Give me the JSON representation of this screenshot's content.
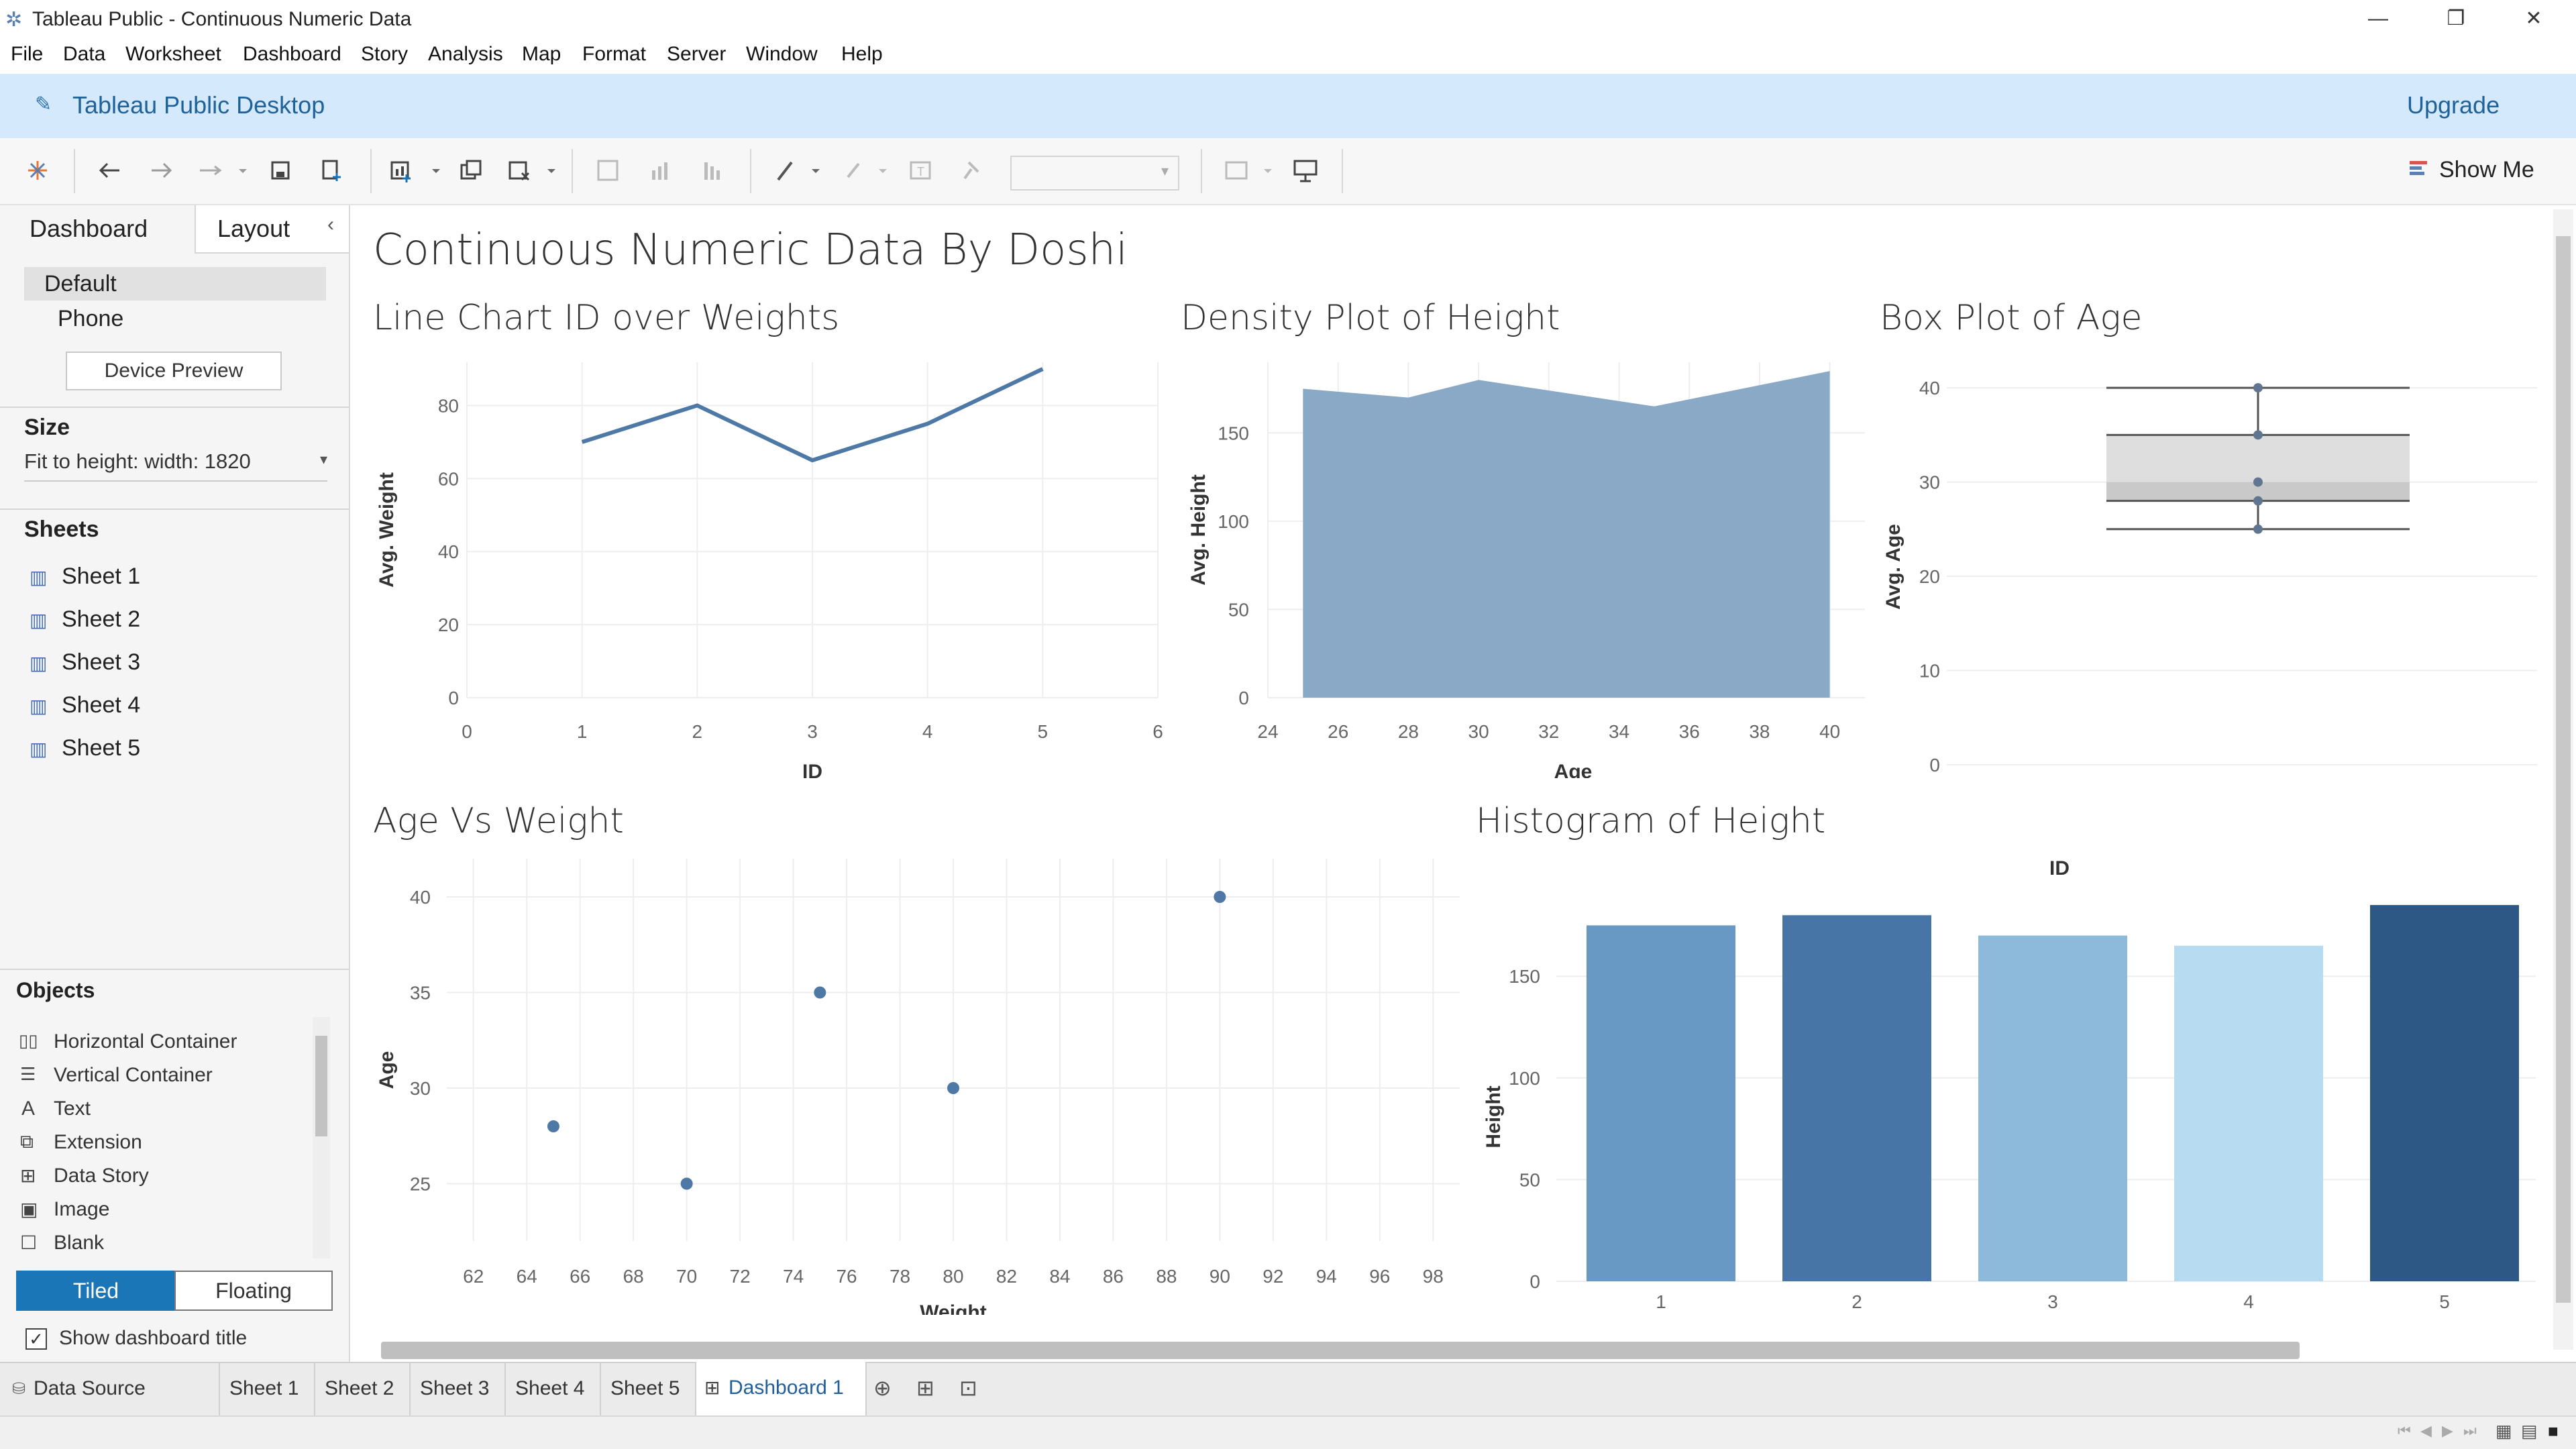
{
  "window": {
    "title": "Tableau Public - Continuous Numeric Data",
    "minimize_icon": "minimize-icon",
    "restore_icon": "restore-icon",
    "close_icon": "close-icon"
  },
  "menu": [
    "File",
    "Data",
    "Worksheet",
    "Dashboard",
    "Story",
    "Analysis",
    "Map",
    "Format",
    "Server",
    "Window",
    "Help"
  ],
  "banner": {
    "app_name": "Tableau Public Desktop",
    "upgrade": "Upgrade"
  },
  "toolbar": {
    "show_me": "Show Me"
  },
  "left_panel": {
    "tabs": {
      "dashboard": "Dashboard",
      "layout": "Layout"
    },
    "devices": [
      "Default",
      "Phone"
    ],
    "device_preview": "Device Preview",
    "size_label": "Size",
    "size_value": "Fit to height: width: 1820",
    "sheets_label": "Sheets",
    "sheets": [
      "Sheet 1",
      "Sheet 2",
      "Sheet 3",
      "Sheet 4",
      "Sheet 5"
    ],
    "objects_label": "Objects",
    "objects": [
      "Horizontal Container",
      "Vertical Container",
      "Text",
      "Extension",
      "Data Story",
      "Image",
      "Blank"
    ],
    "tiled": "Tiled",
    "floating": "Floating",
    "show_title": "Show dashboard title"
  },
  "dashboard": {
    "title": "Continuous Numeric Data By Doshi"
  },
  "chart_data": [
    {
      "type": "line",
      "title": "Line Chart ID over Weights",
      "xlabel": "ID",
      "ylabel": "Avg. Weight",
      "x": [
        1,
        2,
        3,
        4,
        5
      ],
      "values": [
        70,
        80,
        65,
        75,
        90
      ],
      "xticks": [
        0,
        1,
        2,
        3,
        4,
        5,
        6
      ],
      "yticks": [
        0,
        20,
        40,
        60,
        80
      ],
      "xlim": [
        0,
        6
      ],
      "ylim": [
        0,
        90
      ],
      "color": "#4e79a7"
    },
    {
      "type": "area",
      "title": "Density Plot of Height",
      "xlabel": "Age",
      "ylabel": "Avg. Height",
      "x": [
        25,
        28,
        30,
        35,
        40
      ],
      "values": [
        175,
        170,
        180,
        165,
        185
      ],
      "xticks": [
        24,
        26,
        28,
        30,
        32,
        34,
        36,
        38,
        40
      ],
      "yticks": [
        0,
        50,
        100,
        150
      ],
      "xlim": [
        24,
        41
      ],
      "ylim": [
        0,
        190
      ],
      "color": "#8aa9c6"
    },
    {
      "type": "box",
      "title": "Box Plot of Age",
      "ylabel": "Avg. Age",
      "points": [
        25,
        28,
        30,
        35,
        40
      ],
      "whisker_low": 25,
      "q1": 28,
      "median": 30,
      "q3": 35,
      "whisker_high": 40,
      "yticks": [
        0,
        10,
        20,
        30,
        40
      ],
      "ylim": [
        0,
        42
      ]
    },
    {
      "type": "scatter",
      "title": "Age Vs Weight",
      "xlabel": "Weight",
      "ylabel": "Age",
      "points": [
        [
          65,
          28
        ],
        [
          70,
          25
        ],
        [
          75,
          35
        ],
        [
          80,
          30
        ],
        [
          90,
          40
        ]
      ],
      "xticks": [
        62,
        64,
        66,
        68,
        70,
        72,
        74,
        76,
        78,
        80,
        82,
        84,
        86,
        88,
        90,
        92,
        94,
        96,
        98
      ],
      "yticks": [
        25,
        30,
        35,
        40
      ],
      "xlim": [
        61,
        99
      ],
      "ylim": [
        22,
        42
      ],
      "color": "#4e79a7"
    },
    {
      "type": "bar",
      "title": "Histogram of Height",
      "header": "ID",
      "ylabel": "Height",
      "categories": [
        "1",
        "2",
        "3",
        "4",
        "5"
      ],
      "values": [
        175,
        180,
        170,
        165,
        185
      ],
      "colors": [
        "#6799c4",
        "#4775a6",
        "#8dbadb",
        "#b7dbf0",
        "#2d5886"
      ],
      "yticks": [
        0,
        50,
        100,
        150
      ],
      "ylim": [
        0,
        188
      ]
    }
  ],
  "tabs": [
    "Data Source",
    "Sheet 1",
    "Sheet 2",
    "Sheet 3",
    "Sheet 4",
    "Sheet 5",
    "Dashboard 1"
  ]
}
